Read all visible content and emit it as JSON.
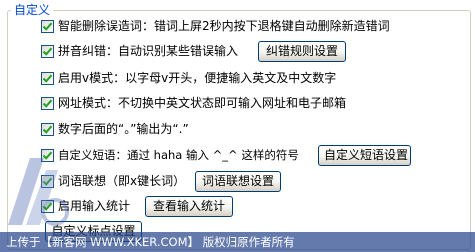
{
  "group": {
    "title": "自定义"
  },
  "options": [
    {
      "label": "智能删除误造词：错词上屏2秒内按下退格键自动删除新造错词",
      "checked": true
    },
    {
      "label": "拼音纠错：自动识别某些错误输入",
      "checked": true,
      "button": "纠错规则设置"
    },
    {
      "label": "启用v模式：以字母v开头，便捷输入英文及中文数字",
      "checked": true
    },
    {
      "label": "网址模式：不切换中英文状态即可输入网址和电子邮箱",
      "checked": true
    },
    {
      "label": "数字后面的“。”输出为“.”",
      "checked": true
    },
    {
      "label": "自定义短语：通过 haha 输入 ^_^ 这样的符号",
      "checked": true,
      "button": "自定义短语设置"
    },
    {
      "label": "词语联想（即x键长词）",
      "checked": true,
      "button": "词语联想设置"
    },
    {
      "label": "启用输入统计",
      "checked": true,
      "button": "查看输入统计"
    }
  ],
  "extra_button": "自定义标点设置",
  "footer": {
    "text": "上传于【新客网 WWW.XKER.COM】 版权归原作者所有"
  },
  "colors": {
    "group_title": "#0046d5",
    "checkmark": "#21a121",
    "footer_bg": "#28468c"
  }
}
